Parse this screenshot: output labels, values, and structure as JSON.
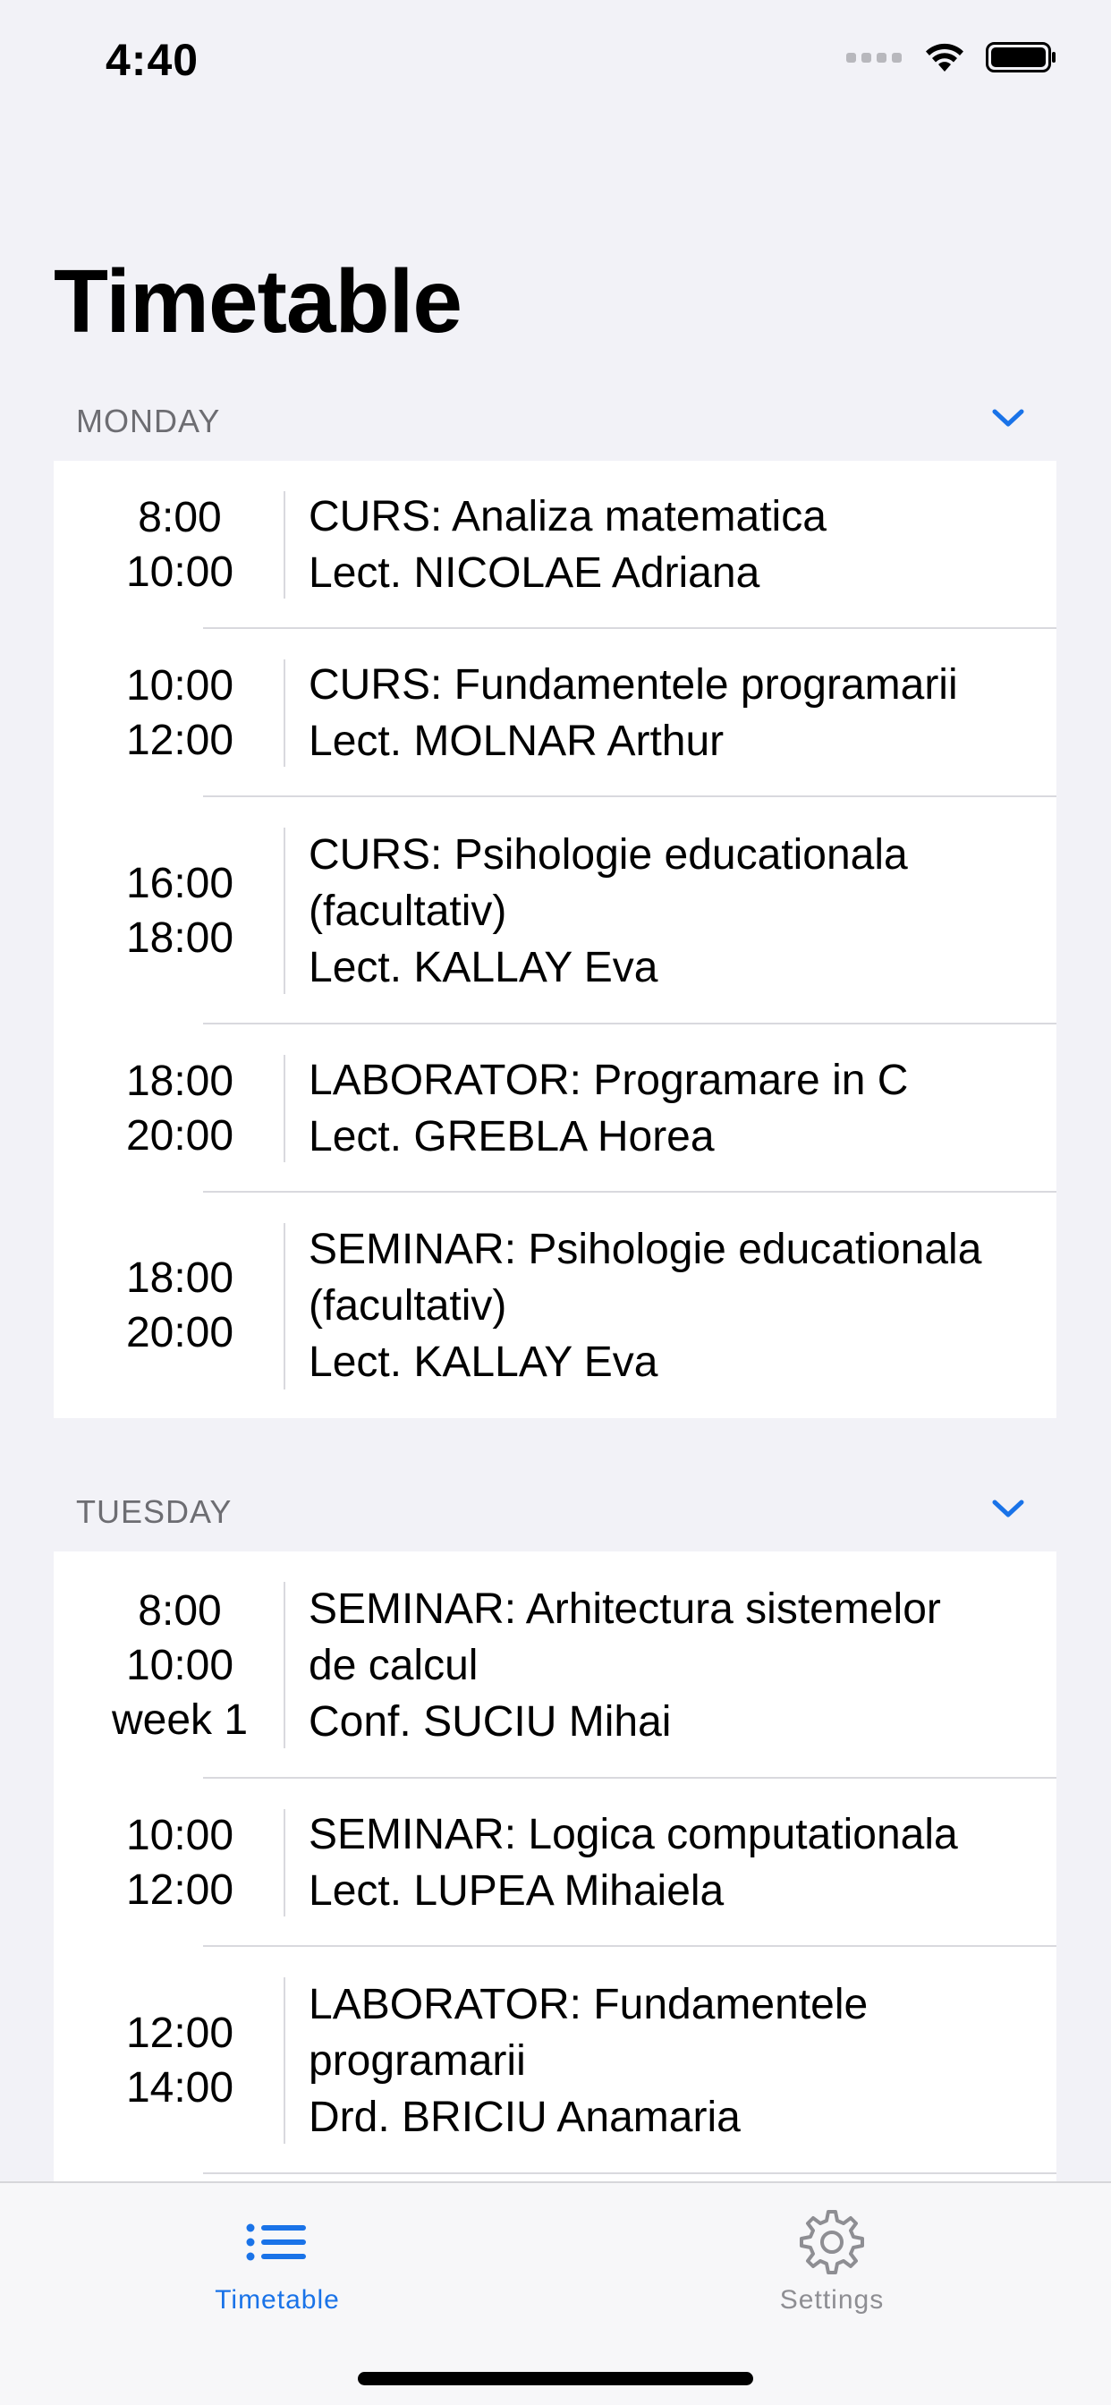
{
  "status_bar": {
    "time": "4:40",
    "icons": [
      "signal-icon",
      "wifi-icon",
      "battery-icon"
    ]
  },
  "title": "Timetable",
  "accent_color": "#1a73e8",
  "sections": [
    {
      "day": "MONDAY",
      "rows": [
        {
          "times": [
            "8:00",
            "10:00"
          ],
          "lines": [
            "CURS: Analiza matematica",
            "Lect. NICOLAE Adriana"
          ]
        },
        {
          "times": [
            "10:00",
            "12:00"
          ],
          "lines": [
            "CURS: Fundamentele programarii",
            "Lect. MOLNAR Arthur"
          ]
        },
        {
          "times": [
            "16:00",
            "18:00"
          ],
          "lines": [
            "CURS: Psihologie educationala",
            "(facultativ)",
            "Lect. KALLAY Eva"
          ]
        },
        {
          "times": [
            "18:00",
            "20:00"
          ],
          "lines": [
            "LABORATOR: Programare in C",
            "Lect. GREBLA Horea"
          ]
        },
        {
          "times": [
            "18:00",
            "20:00"
          ],
          "lines": [
            "SEMINAR: Psihologie educationala",
            "(facultativ)",
            "Lect. KALLAY Eva"
          ]
        }
      ]
    },
    {
      "day": "TUESDAY",
      "rows": [
        {
          "times": [
            "8:00",
            "10:00",
            "week 1"
          ],
          "lines": [
            "SEMINAR: Arhitectura sistemelor",
            "de calcul",
            "Conf. SUCIU Mihai"
          ]
        },
        {
          "times": [
            "10:00",
            "12:00"
          ],
          "lines": [
            "SEMINAR: Logica computationala",
            "Lect. LUPEA Mihaiela"
          ]
        },
        {
          "times": [
            "12:00",
            "14:00"
          ],
          "lines": [
            "LABORATOR: Fundamentele",
            "programarii",
            "Drd. BRICIU Anamaria"
          ]
        }
      ]
    }
  ],
  "tab_bar": {
    "tabs": [
      {
        "label": "Timetable",
        "icon": "list-icon",
        "selected": true
      },
      {
        "label": "Settings",
        "icon": "gear-icon",
        "selected": false
      }
    ]
  }
}
